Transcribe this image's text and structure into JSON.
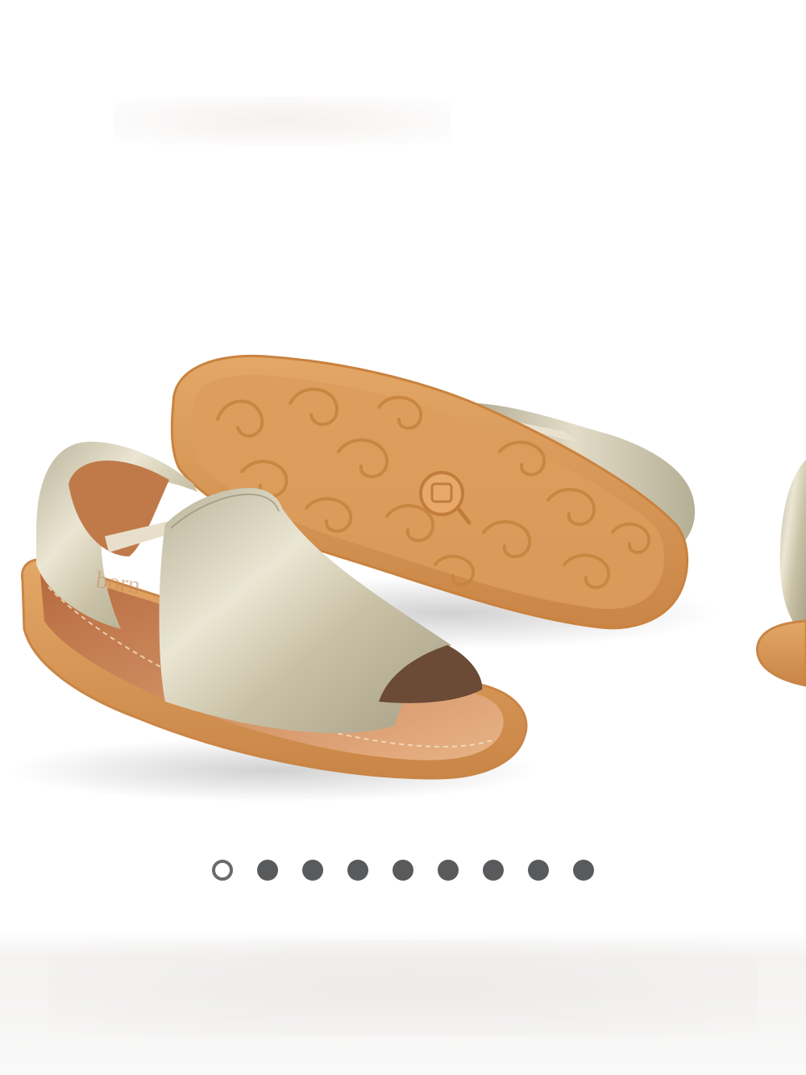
{
  "gallery": {
    "image": {
      "subject": "sandal-pair",
      "sole_logo_text": "",
      "brand_emboss_text": "born"
    },
    "carousel": {
      "total_slides": 9,
      "active_index": 0
    }
  },
  "colors": {
    "metallic_upper": "#cfc7ad",
    "sole_gum": "#d99a5c",
    "insole": "#e2a878",
    "dot_active_border": "#6a6a6a",
    "dot_inactive": "#595a5b"
  }
}
